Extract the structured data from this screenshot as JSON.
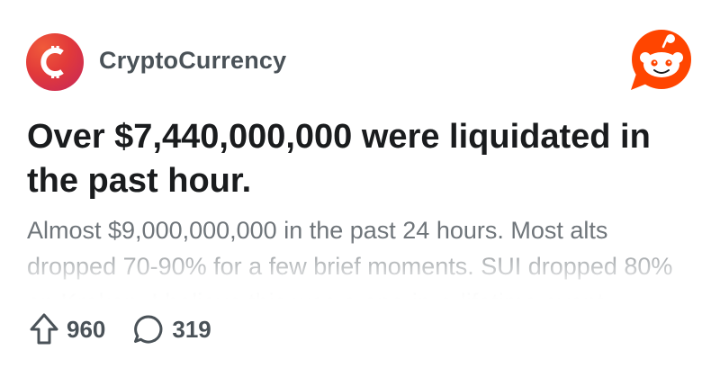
{
  "post": {
    "subreddit": "CryptoCurrency",
    "title": "Over $7,440,000,000 were liquidated in the past hour.",
    "body": "Almost $9,000,000,000 in the past 24 hours. Most alts dropped 70-90% for a few brief moments. SUI dropped 80% on Kraken. I believe this was a one-in-a-lifetime event."
  },
  "stats": {
    "upvotes": "960",
    "comments": "319"
  },
  "colors": {
    "subreddit_icon": "#e23a3a",
    "reddit_brand": "#ff4500",
    "title_text": "#1a1c1e",
    "body_text": "#6f757a"
  },
  "icons": {
    "subreddit": "crypto-c-icon",
    "brand": "reddit-snoo-icon",
    "upvote": "upvote-arrow-icon",
    "comment": "comment-bubble-icon"
  }
}
